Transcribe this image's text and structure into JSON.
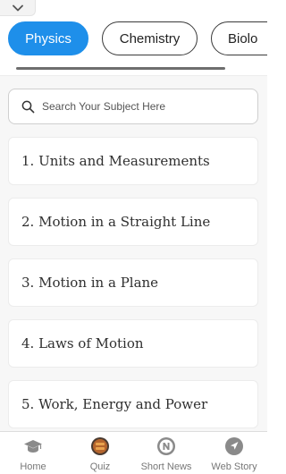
{
  "tabs": [
    {
      "label": "Physics",
      "active": true
    },
    {
      "label": "Chemistry",
      "active": false
    },
    {
      "label": "Biolo",
      "active": false
    }
  ],
  "search": {
    "placeholder": "Search Your Subject Here",
    "icon": "search-icon"
  },
  "chapters": [
    {
      "label": "1. Units and Measurements"
    },
    {
      "label": "2. Motion in a Straight Line"
    },
    {
      "label": "3. Motion in a Plane"
    },
    {
      "label": "4. Laws of Motion"
    },
    {
      "label": "5. Work, Energy and Power"
    }
  ],
  "bottom_nav": [
    {
      "label": "Home",
      "icon": "graduation-cap-icon"
    },
    {
      "label": "Quiz",
      "icon": "quiz-icon"
    },
    {
      "label": "Short News",
      "icon": "news-icon"
    },
    {
      "label": "Web Story",
      "icon": "navigation-arrow-icon"
    }
  ],
  "colors": {
    "accent": "#1e8fea",
    "text": "#2f2f2f",
    "muted": "#777777"
  }
}
